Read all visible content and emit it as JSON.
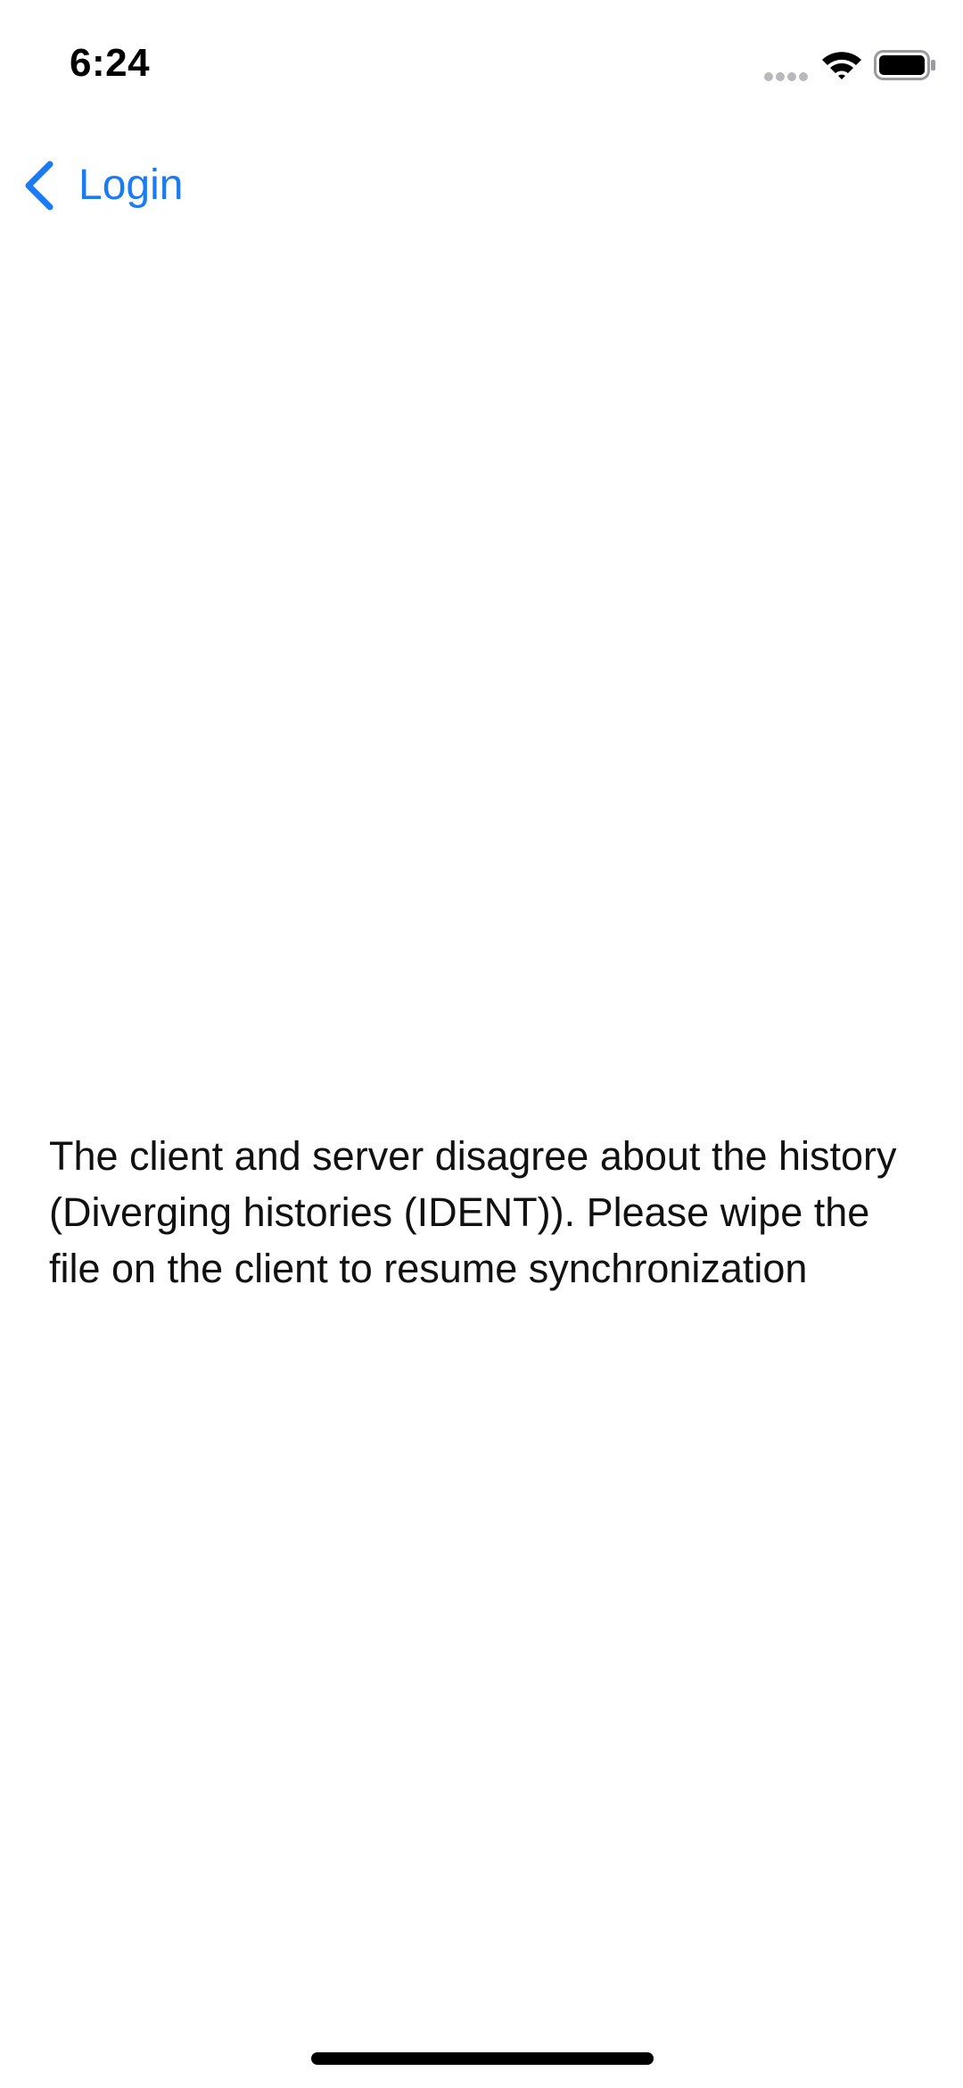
{
  "status_bar": {
    "time": "6:24",
    "icons": [
      "signal-dots-icon",
      "wifi-icon",
      "battery-icon"
    ]
  },
  "nav": {
    "back_label": "Login",
    "back_icon": "chevron-left-icon",
    "accent_color": "#1a7bf5"
  },
  "main": {
    "message": "The client and server disagree about the history (Diverging histories (IDENT)). Please wipe the file on the client to resume synchronization"
  }
}
